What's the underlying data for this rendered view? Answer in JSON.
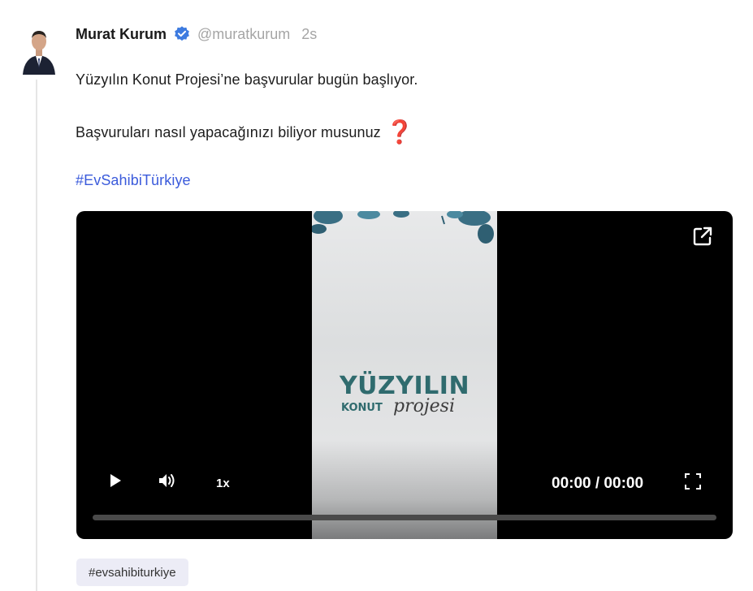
{
  "post": {
    "author_name": "Murat Kurum",
    "handle": "@muratkurum",
    "time_ago": "2s",
    "line1": "Yüzyılın Konut Projesi’ne başvurular bugün başlıyor.",
    "line2": "Başvuruları nasıl yapacağınızı biliyor musunuz",
    "line2_emoji": "❓",
    "hashtag": "#EvSahibiTürkiye"
  },
  "video": {
    "poster_title": "YÜZYILIN",
    "poster_sub": "KONUT",
    "poster_script": "projesi",
    "speed_label": "1x",
    "timecode": "00:00 / 00:00",
    "progress": 0.0,
    "icons": {
      "external": "external-link-icon",
      "play": "play-icon",
      "volume": "volume-icon",
      "fullscreen": "fullscreen-icon"
    }
  },
  "tags": [
    "#evsahibiturkiye"
  ],
  "colors": {
    "hashtag": "#3b5bdb",
    "verified": "#3d7be0",
    "muted": "#a5a5a5",
    "chip_bg": "#ececf6"
  }
}
